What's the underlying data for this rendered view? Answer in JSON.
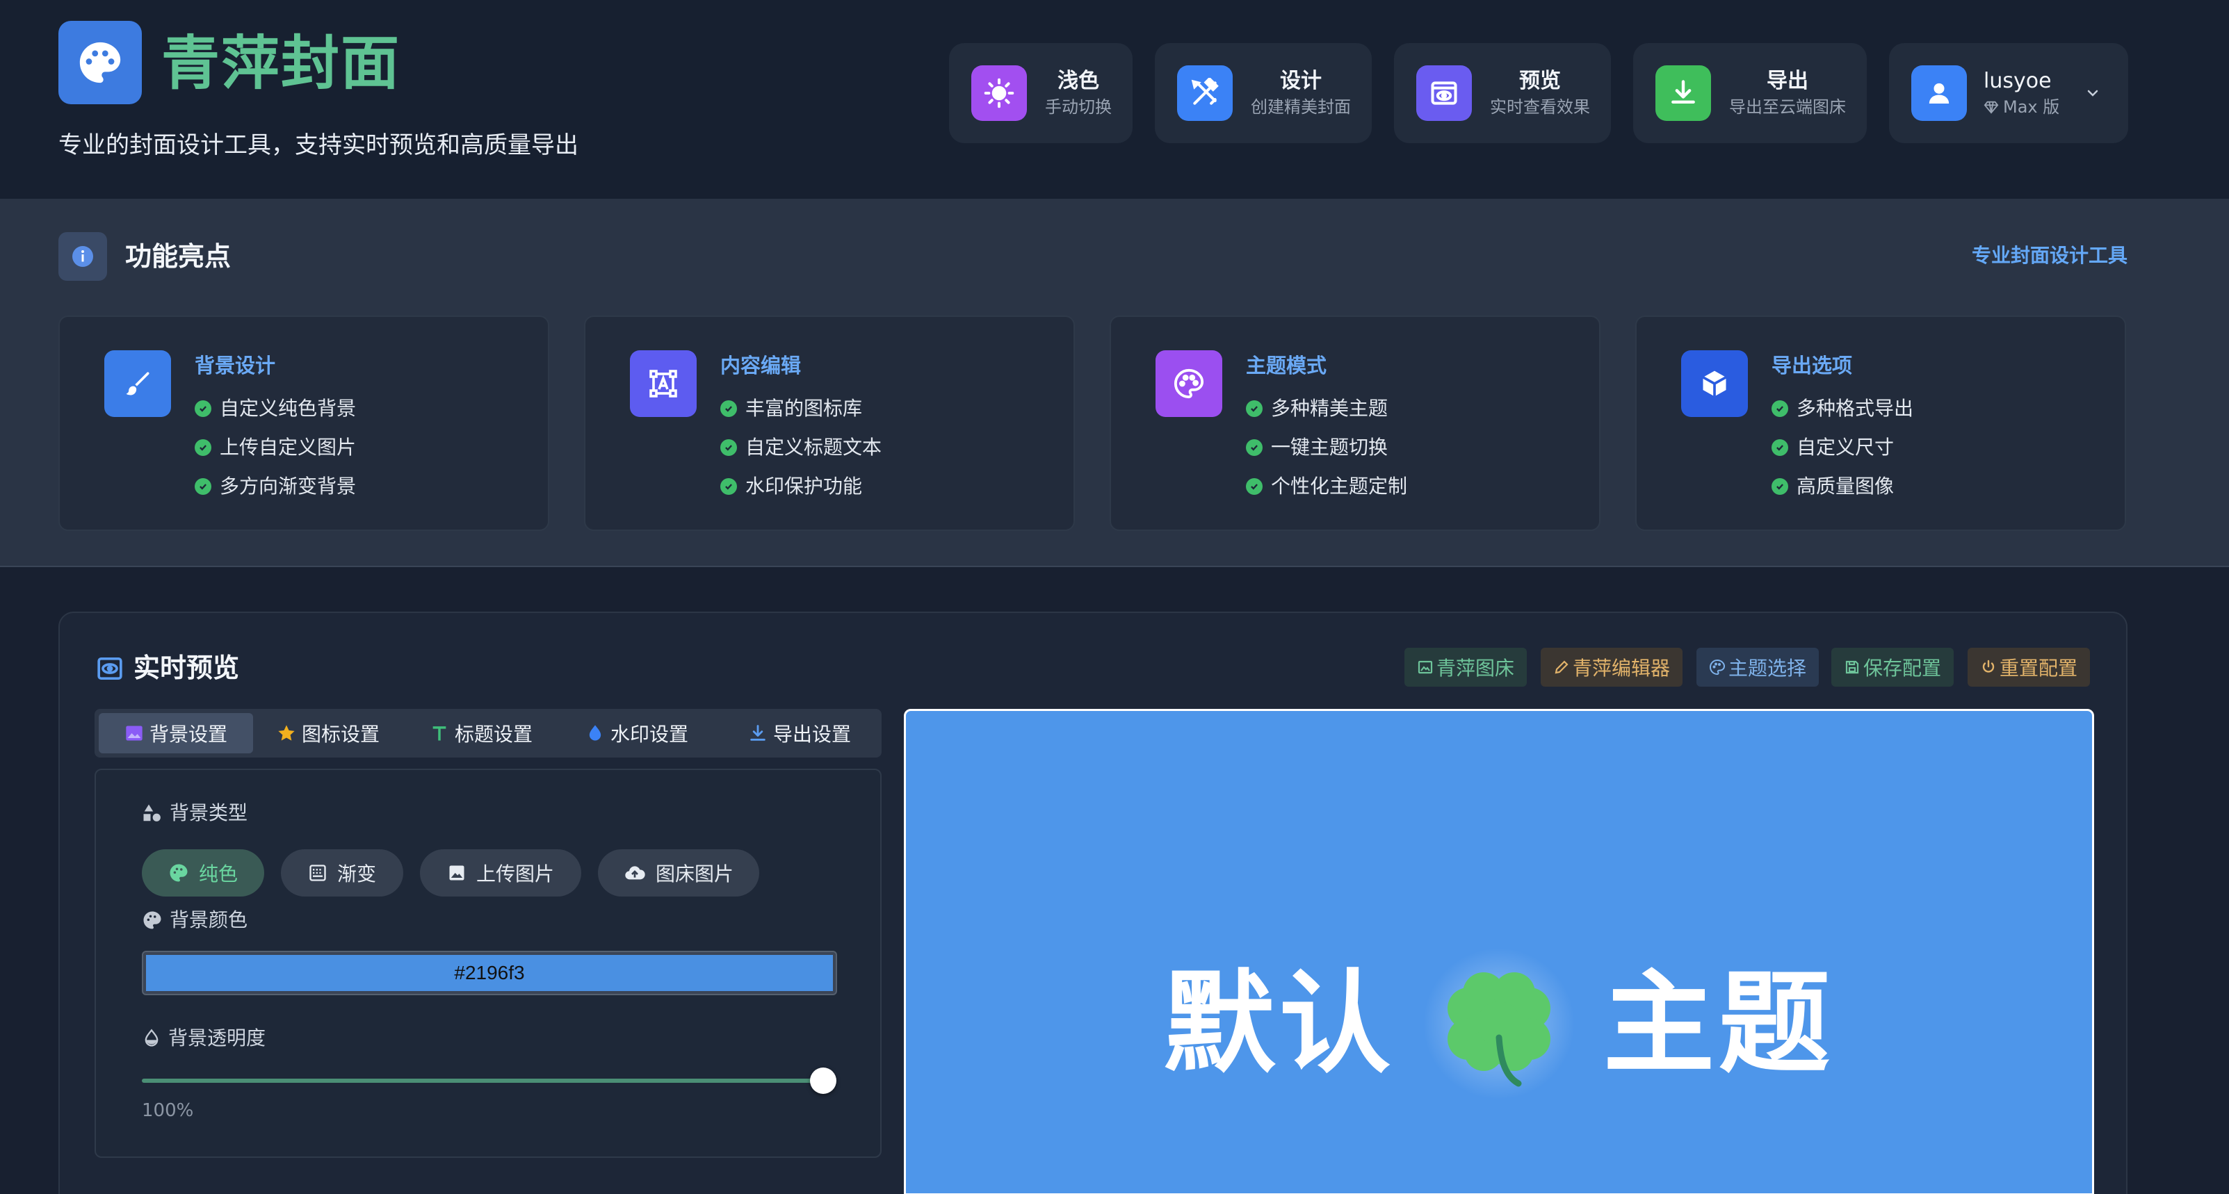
{
  "header": {
    "title": "青萍封面",
    "subtitle": "专业的封面设计工具，支持实时预览和高质量导出",
    "buttons": [
      {
        "title": "浅色",
        "sub": "手动切换",
        "color": "#a24ff0"
      },
      {
        "title": "设计",
        "sub": "创建精美封面",
        "color": "#3b82f6"
      },
      {
        "title": "预览",
        "sub": "实时查看效果",
        "color": "#6a5cf0"
      },
      {
        "title": "导出",
        "sub": "导出至云端图床",
        "color": "#3fbe5b"
      }
    ],
    "user": {
      "name": "lusyoe",
      "plan": "Max 版",
      "color": "#3b82f6"
    }
  },
  "features": {
    "title": "功能亮点",
    "link": "专业封面设计工具",
    "cards": [
      {
        "title": "背景设计",
        "color": "#3b7de8",
        "items": [
          "自定义纯色背景",
          "上传自定义图片",
          "多方向渐变背景"
        ]
      },
      {
        "title": "内容编辑",
        "color": "#5d5cf0",
        "items": [
          "丰富的图标库",
          "自定义标题文本",
          "水印保护功能"
        ]
      },
      {
        "title": "主题模式",
        "color": "#9b4ff0",
        "items": [
          "多种精美主题",
          "一键主题切换",
          "个性化主题定制"
        ]
      },
      {
        "title": "导出选项",
        "color": "#2a5ce0",
        "items": [
          "多种格式导出",
          "自定义尺寸",
          "高质量图像"
        ]
      }
    ]
  },
  "preview": {
    "title": "实时预览",
    "actions": [
      {
        "label": "青萍图床",
        "color": "#6ec49a",
        "bg": "#263b3c"
      },
      {
        "label": "青萍编辑器",
        "color": "#e2b36a",
        "bg": "#3b3631"
      },
      {
        "label": "主题选择",
        "color": "#7fb2ea",
        "bg": "#2a3a52"
      },
      {
        "label": "保存配置",
        "color": "#6ec49a",
        "bg": "#263b3c"
      },
      {
        "label": "重置配置",
        "color": "#e2b36a",
        "bg": "#3b3631"
      }
    ],
    "tabs": [
      "背景设置",
      "图标设置",
      "标题设置",
      "水印设置",
      "导出设置"
    ],
    "settings": {
      "bg_type_label": "背景类型",
      "bg_types": [
        "纯色",
        "渐变",
        "上传图片",
        "图床图片"
      ],
      "bg_color_label": "背景颜色",
      "bg_color_value": "#2196f3",
      "bg_opacity_label": "背景透明度",
      "bg_opacity_value": "100%",
      "bg_opacity_fraction": 1.0
    },
    "cover": {
      "left_text": "默认",
      "right_text": "主题",
      "icon": "four-leaf-clover-icon",
      "background": "#4e96ea"
    }
  }
}
